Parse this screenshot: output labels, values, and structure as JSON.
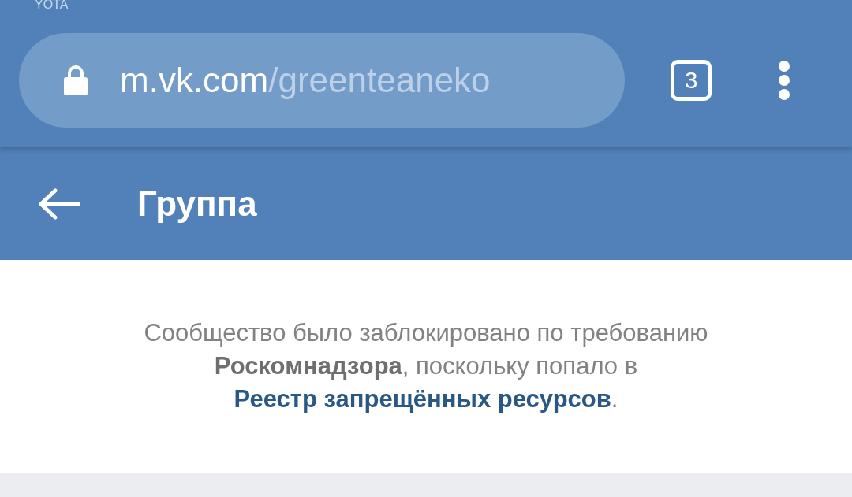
{
  "status_bar": {
    "carrier": "YOTA"
  },
  "browser": {
    "url_host": "m.vk.com",
    "url_path": "/greenteaneko",
    "secure": true,
    "tab_count": "3"
  },
  "header": {
    "title": "Группа"
  },
  "message": {
    "parts": [
      {
        "kind": "plain",
        "text": "Сообщество было заблокировано по требованию "
      },
      {
        "kind": "bold",
        "text": "Роскомнадзора"
      },
      {
        "kind": "plain",
        "text": ", поскольку попало в "
      },
      {
        "kind": "link",
        "text": "Реестр запрещённых ресурсов"
      },
      {
        "kind": "plain",
        "text": "."
      }
    ]
  }
}
